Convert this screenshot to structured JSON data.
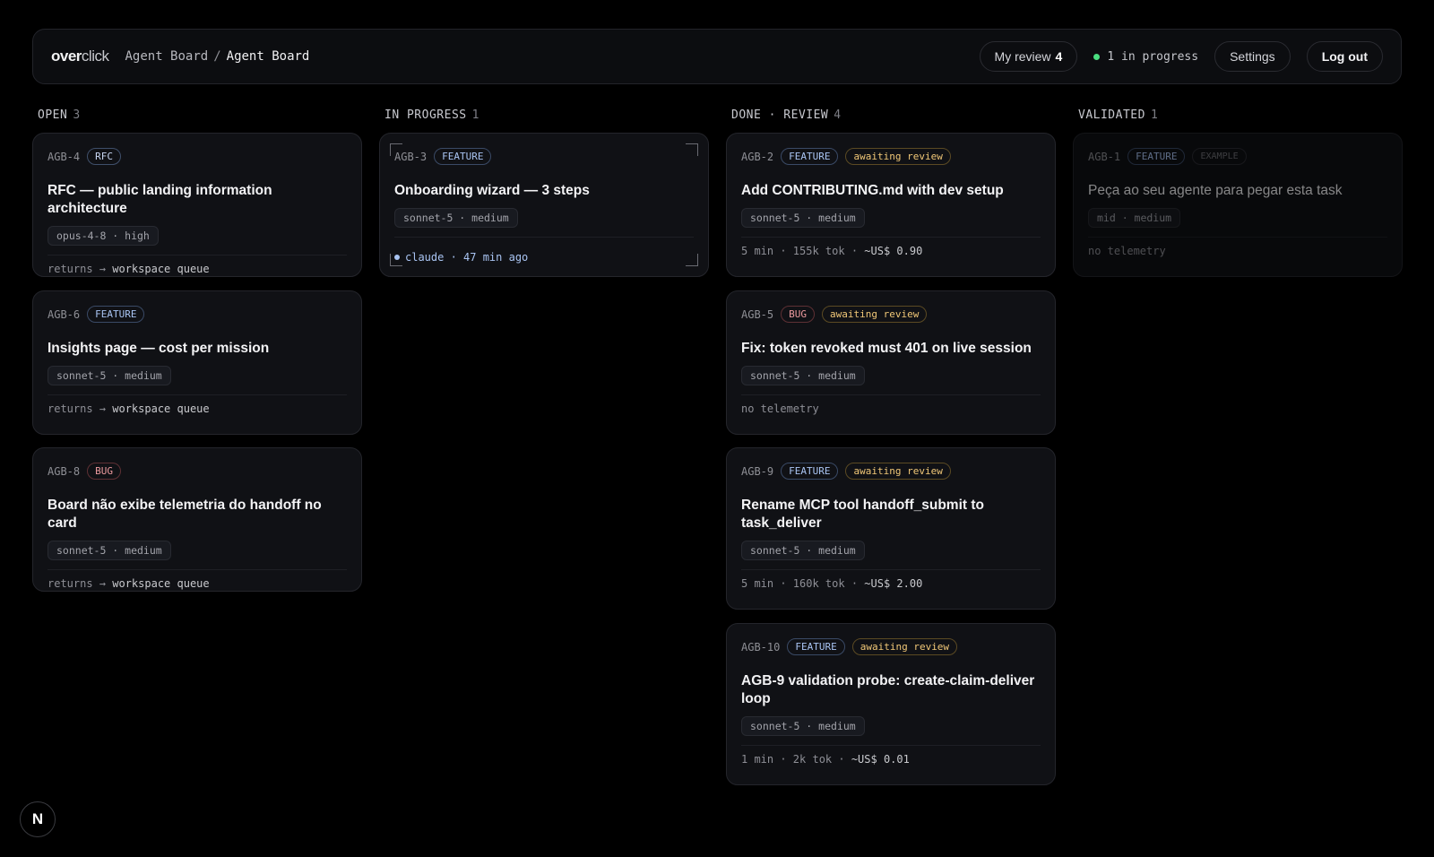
{
  "header": {
    "logo_bold": "over",
    "logo_light": "click",
    "breadcrumb_parent": "Agent Board",
    "breadcrumb_sep": "/",
    "breadcrumb_current": "Agent Board",
    "my_review_label": "My review",
    "my_review_count": "4",
    "status_text": "1 in progress",
    "settings_label": "Settings",
    "logout_label": "Log out"
  },
  "columns": [
    {
      "label": "OPEN",
      "count": "3"
    },
    {
      "label": "IN PROGRESS",
      "count": "1"
    },
    {
      "label": "DONE · REVIEW",
      "count": "4"
    },
    {
      "label": "VALIDATED",
      "count": "1"
    }
  ],
  "cards": {
    "agb4": {
      "id": "AGB-4",
      "type": "RFC",
      "title": "RFC — public landing information architecture",
      "model": "opus-4-8 · high",
      "foot_a": "returns → ",
      "foot_b": "workspace queue"
    },
    "agb6": {
      "id": "AGB-6",
      "type": "FEATURE",
      "title": "Insights page — cost per mission",
      "model": "sonnet-5 · medium",
      "foot_a": "returns → ",
      "foot_b": "workspace queue"
    },
    "agb8": {
      "id": "AGB-8",
      "type": "BUG",
      "title": "Board não exibe telemetria do handoff no card",
      "model": "sonnet-5 · medium",
      "foot_a": "returns → ",
      "foot_b": "workspace queue"
    },
    "agb3": {
      "id": "AGB-3",
      "type": "FEATURE",
      "title": "Onboarding wizard — 3 steps",
      "model": "sonnet-5 · medium",
      "foot": "claude · 47 min ago"
    },
    "agb2": {
      "id": "AGB-2",
      "type": "FEATURE",
      "review": "awaiting review",
      "title": "Add CONTRIBUTING.md with dev setup",
      "model": "sonnet-5 · medium",
      "foot_a": "5 min · 155k tok · ",
      "foot_b": "~US$ 0.90"
    },
    "agb5": {
      "id": "AGB-5",
      "type": "BUG",
      "review": "awaiting review",
      "title": "Fix: token revoked must 401 on live session",
      "model": "sonnet-5 · medium",
      "foot": "no telemetry"
    },
    "agb9": {
      "id": "AGB-9",
      "type": "FEATURE",
      "review": "awaiting review",
      "title": "Rename MCP tool handoff_submit to task_deliver",
      "model": "sonnet-5 · medium",
      "foot_a": "5 min · 160k tok · ",
      "foot_b": "~US$ 2.00"
    },
    "agb10": {
      "id": "AGB-10",
      "type": "FEATURE",
      "review": "awaiting review",
      "title": "AGB-9 validation probe: create-claim-deliver loop",
      "model": "sonnet-5 · medium",
      "foot_a": "1 min · 2k tok · ",
      "foot_b": "~US$ 0.01"
    },
    "agb1": {
      "id": "AGB-1",
      "type": "FEATURE",
      "example": "EXAMPLE",
      "title": "Peça ao seu agente para pegar esta task",
      "model": "mid · medium",
      "foot": "no telemetry"
    }
  },
  "dev_badge": "N"
}
